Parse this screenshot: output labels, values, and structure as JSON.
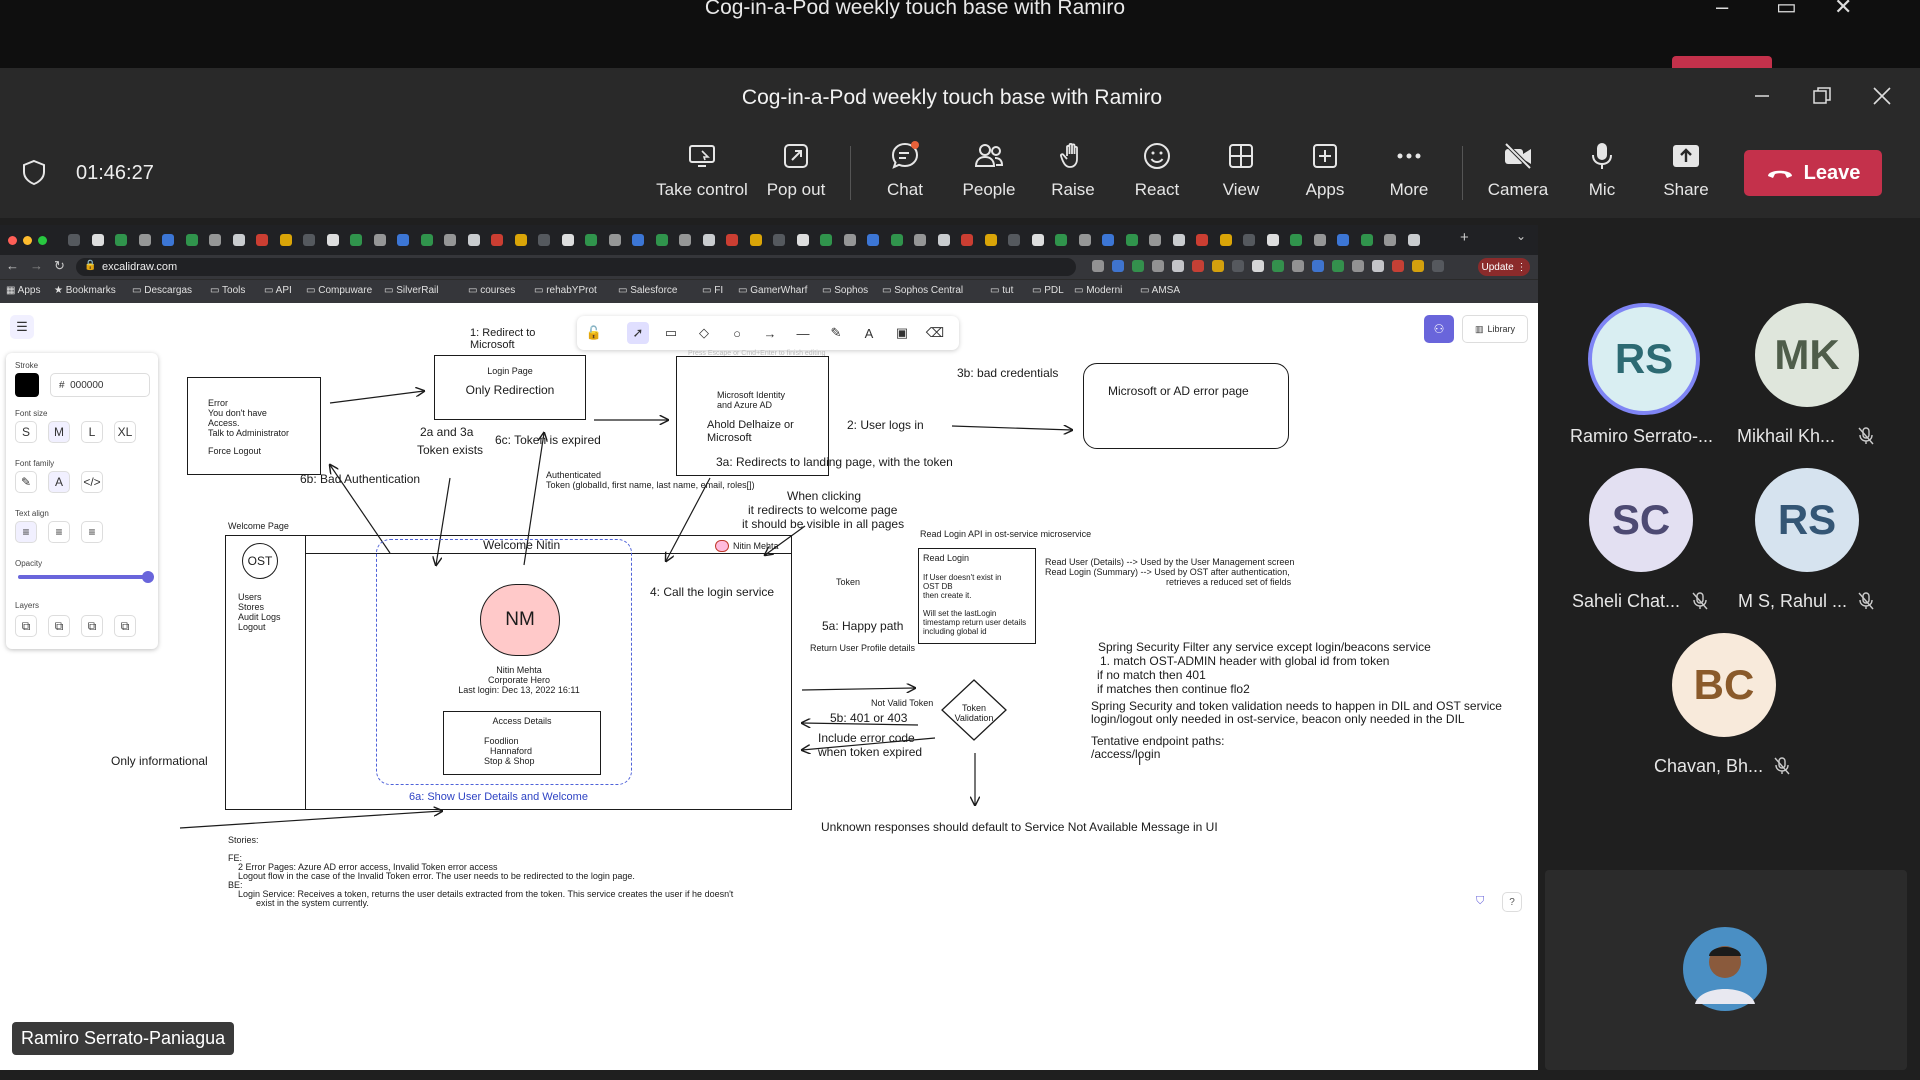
{
  "background_window": {
    "title": "Cog-in-a-Pod weekly touch base with Ramiro"
  },
  "window": {
    "title": "Cog-in-a-Pod weekly touch base with Ramiro"
  },
  "meeting": {
    "timer": "01:46:27"
  },
  "toolbar": {
    "take_control": "Take control",
    "pop_out": "Pop out",
    "chat": "Chat",
    "people": "People",
    "raise": "Raise",
    "react": "React",
    "view": "View",
    "apps": "Apps",
    "more": "More",
    "camera": "Camera",
    "mic": "Mic",
    "share": "Share",
    "leave": "Leave",
    "leave_color": "#c4314b"
  },
  "browser": {
    "url": "excalidraw.com",
    "update_label": "Update",
    "bookmarks": [
      "Apps",
      "Bookmarks",
      "Descargas",
      "Tools",
      "API",
      "Compuware",
      "SilverRail",
      "courses",
      "rehabYProt",
      "Salesforce",
      "FI",
      "GamerWharf",
      "Sophos",
      "Sophos Central",
      "tut",
      "PDL",
      "Moderni",
      "AMSA"
    ]
  },
  "excalidraw": {
    "stroke_label": "Stroke",
    "stroke_hex": "000000",
    "hex_prefix": "#",
    "font_size_label": "Font size",
    "font_sizes": [
      "S",
      "M",
      "L",
      "XL"
    ],
    "font_family_label": "Font family",
    "text_align_label": "Text align",
    "opacity_label": "Opacity",
    "layers_label": "Layers",
    "library_label": "Library",
    "hint": "Press Escape or Cmd+Enter to finish editing"
  },
  "diagram": {
    "error_box": [
      "Error",
      "You don't have",
      "Access.",
      "Talk to Administrator",
      "",
      "Force Logout"
    ],
    "step1": [
      "1: Redirect to",
      "Microsoft"
    ],
    "login_title": "Login Page",
    "login_sub": "Only Redirection",
    "ms_box": [
      "Microsoft Identity",
      "and Azure AD",
      "",
      "Ahold Delhaize or",
      "Microsoft"
    ],
    "step2": "2: User logs in",
    "step3b": "3b: bad credentials",
    "error_page": "Microsoft or AD error page",
    "step2a": [
      "2a and 3a",
      "Token exists"
    ],
    "step6c": "6c: Token is expired",
    "step6b": "6b: Bad Authentication",
    "authenticated": [
      "Authenticated",
      "Token (globalId, first name, last name, email, roles[])"
    ],
    "step3a": "3a: Redirects to landing page, with the token",
    "when_clicking": [
      "When clicking",
      "it redirects to welcome page",
      "it should be visible in all pages"
    ],
    "welcome_page_label": "Welcome Page",
    "logo": "OST",
    "menu": [
      "Users",
      "Stores",
      "Audit Logs",
      "Logout"
    ],
    "welcome_title": "Welcome Nitin",
    "user_chip": "Nitin Mehta",
    "avatar": "NM",
    "profile": [
      "Nitin Mehta",
      "Corporate Hero",
      "Last login: Dec 13, 2022 16:11"
    ],
    "access_title": "Access Details",
    "access_items": [
      "Foodlion",
      "Hannaford",
      "Stop & Shop"
    ],
    "step6a": "6a: Show User Details and Welcome",
    "only_informational": "Only informational",
    "step4": "4: Call the login service",
    "read_login_api": "Read Login API in ost-service microservice",
    "token_label": "Token",
    "read_login_box": [
      "Read Login",
      "",
      "If User doesn't exist in",
      "OST DB",
      "then create it.",
      "",
      "Will set the lastLogin",
      "timestamp return user details",
      "including global id"
    ],
    "read_user_notes": [
      "Read User (Details) --> Used by the User Management screen",
      "Read Login (Summary) --> Used by OST after authentication,",
      "retrieves a reduced set of fields"
    ],
    "step5a": "5a: Happy path",
    "return_profile": "Return User Profile details",
    "not_valid": "Not Valid Token",
    "token_validation": [
      "Token",
      "Validation"
    ],
    "step5b": "5b: 401 or 403",
    "include_error": [
      "Include error code",
      "when token expired"
    ],
    "spring": [
      "Spring Security Filter any service except login/beacons service",
      "1. match OST-ADMIN header with global id from token",
      "if no match then 401",
      "if matches then continue flo2"
    ],
    "spring2": [
      "Spring Security and token validation needs to happen in DIL and OST service",
      "login/logout only needed in ost-service, beacon only needed in the DIL"
    ],
    "tentative": [
      "Tentative endpoint paths:",
      "/access/login"
    ],
    "unknown": "Unknown responses should default to Service Not Available Message in UI",
    "stories": [
      "Stories:",
      "",
      "FE:",
      "2 Error Pages: Azure AD error access, Invalid Token error access",
      "Logout flow in the case of the Invalid Token error. The user needs to be redirected to the login page.",
      "BE:",
      "Login Service: Receives a token, returns the user details extracted from the token. This service creates the user if he doesn't",
      "exist in the system currently."
    ]
  },
  "participants": [
    {
      "initials": "RS",
      "name": "Ramiro Serrato-...",
      "bg": "#d9eef2",
      "fg": "#2d6a73"
    },
    {
      "initials": "MK",
      "name": "Mikhail Kh...",
      "bg": "#dfe6dc",
      "fg": "#4f5d4a"
    },
    {
      "initials": "SC",
      "name": "Saheli Chat...",
      "bg": "#e3e0f2",
      "fg": "#4d4a73"
    },
    {
      "initials": "RS",
      "name": "M S, Rahul ...",
      "bg": "#d6e3ef",
      "fg": "#345675"
    },
    {
      "initials": "BC",
      "name": "Chavan, Bh...",
      "bg": "#f8eadb",
      "fg": "#8a5a2b"
    }
  ],
  "presenter_tag": "Ramiro Serrato-Paniagua"
}
